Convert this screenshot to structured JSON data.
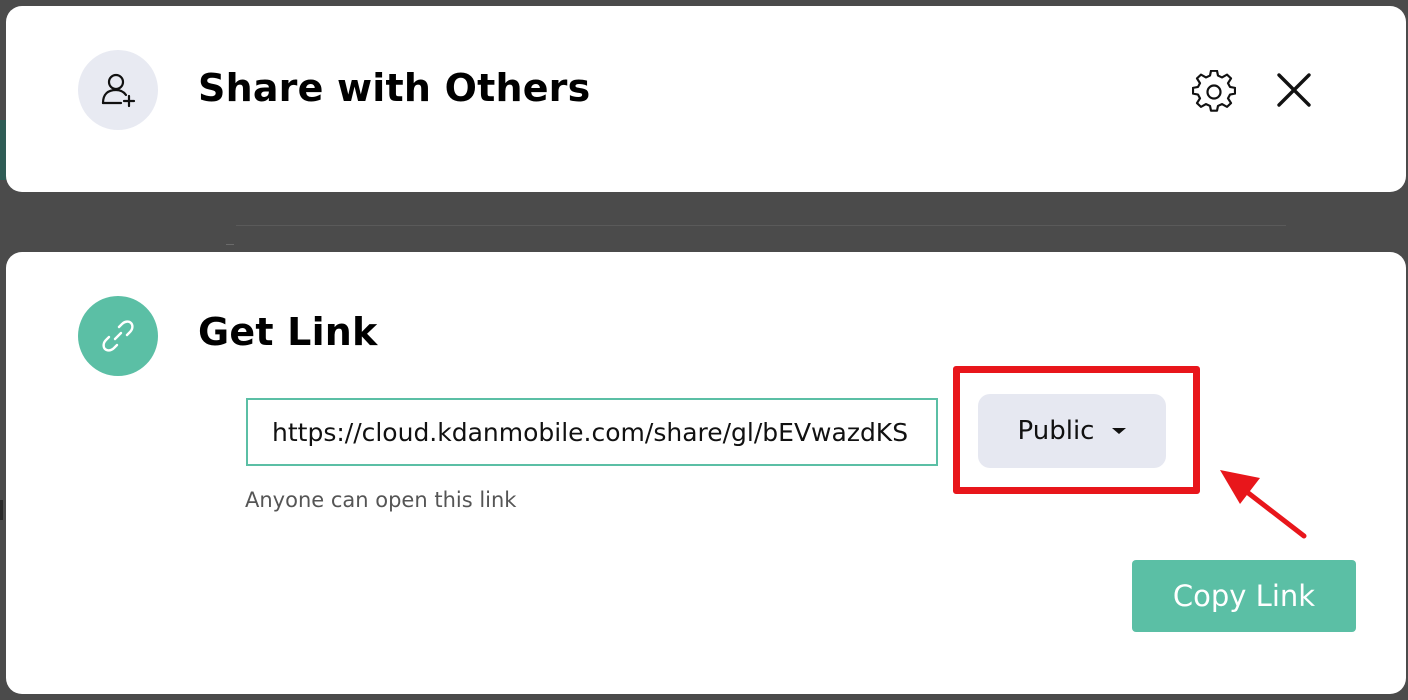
{
  "share_card": {
    "title": "Share with Others",
    "icon": "add-user-icon",
    "settings_icon": "gear-icon",
    "close_icon": "close-icon"
  },
  "link_card": {
    "title": "Get Link",
    "icon": "link-icon",
    "url": "https://cloud.kdanmobile.com/share/gl/bEVwazdKS",
    "permission": {
      "selected": "Public",
      "icon": "caret-down-icon"
    },
    "hint": "Anyone can open this link",
    "copy_label": "Copy Link"
  },
  "annotation": {
    "highlight_color": "#e8161b"
  },
  "colors": {
    "accent": "#5bbfa5",
    "overlay": "#4b4b4b",
    "chip": "#e6e8f1"
  }
}
